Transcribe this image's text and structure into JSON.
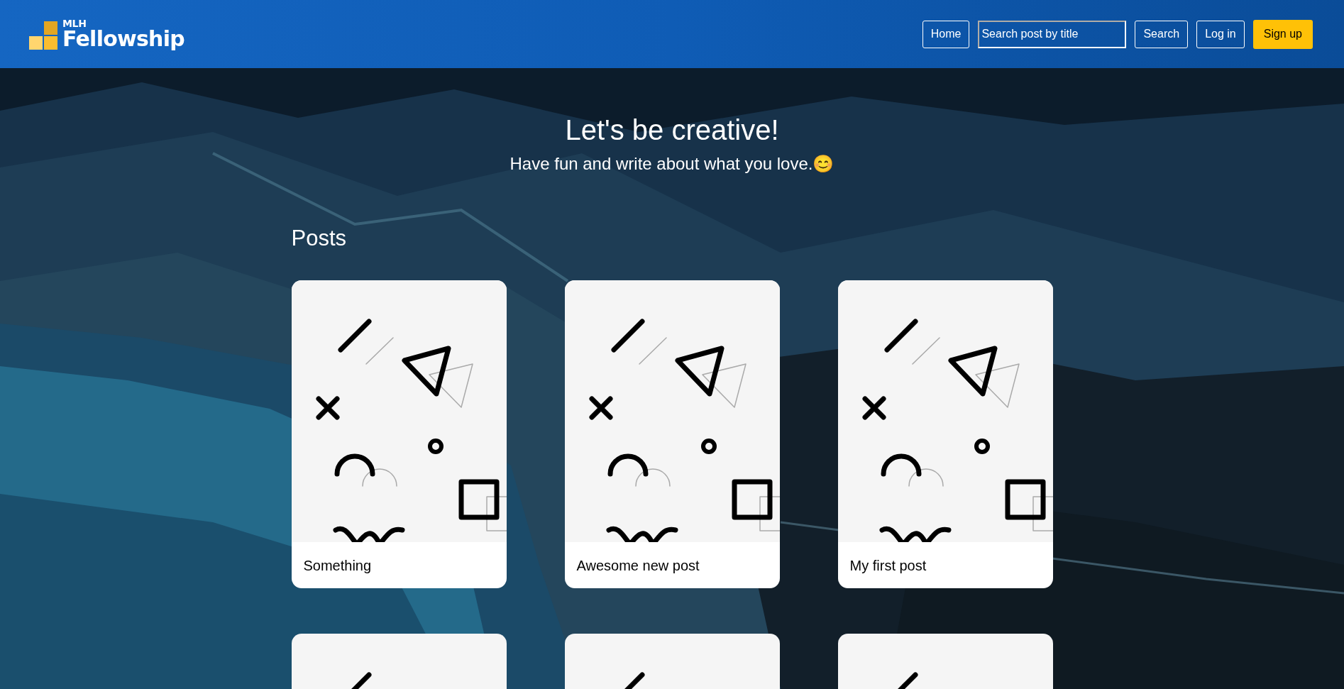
{
  "header": {
    "logo_small": "MLH",
    "logo_large": "Fellowship",
    "nav": [
      {
        "kind": "button",
        "label": "Home"
      },
      {
        "kind": "field",
        "placeholder": "Search post by title"
      },
      {
        "kind": "button",
        "label": "Search"
      },
      {
        "kind": "button",
        "label": "Log in"
      },
      {
        "kind": "primary",
        "label": "Sign up"
      }
    ]
  },
  "hero": {
    "title": "Let's be creative!",
    "subtitle": "Have fun and write about what you love.😊"
  },
  "posts_heading": "Posts",
  "posts": [
    {
      "kind": "full",
      "title": "Something"
    },
    {
      "kind": "full",
      "title": "Awesome new post"
    },
    {
      "kind": "full",
      "title": "My first post"
    },
    {
      "kind": "cut"
    },
    {
      "kind": "cut"
    },
    {
      "kind": "cut"
    }
  ]
}
